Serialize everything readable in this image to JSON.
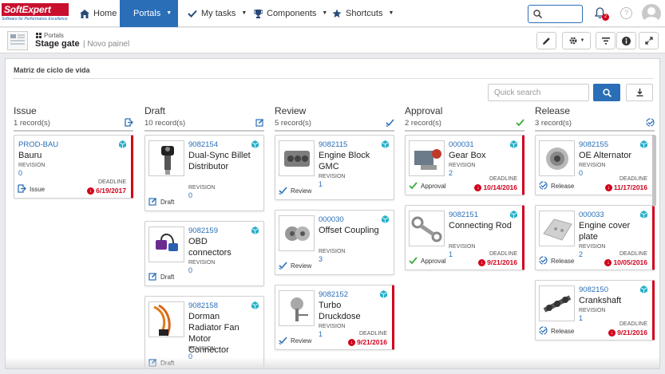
{
  "brand": {
    "name": "SoftExpert",
    "tagline": "Software for Performance Excellence",
    "color": "#c8102e"
  },
  "nav": [
    {
      "label": "Home",
      "icon": "home-icon"
    },
    {
      "label": "Portals",
      "icon": "grid-icon",
      "active": true
    },
    {
      "label": "My tasks",
      "icon": "check-icon"
    },
    {
      "label": "Components",
      "icon": "trophy-icon"
    },
    {
      "label": "Shortcuts",
      "icon": "star-icon"
    }
  ],
  "notifications": {
    "count": "2"
  },
  "help_label": "?",
  "breadcrumb": {
    "label": "Portals"
  },
  "page": {
    "title": "Stage gate",
    "subtitle": "| Novo painel"
  },
  "panel": {
    "title": "Matriz de ciclo de vida",
    "search_placeholder": "Quick search"
  },
  "accent_color": "#2a6eb7",
  "alert_color": "#d0021b",
  "columns": [
    {
      "name": "Issue",
      "count": "1 record(s)",
      "icon": "issue-stage-icon",
      "cards": [
        {
          "id": "PROD-BAU",
          "name": "Bauru",
          "revision_label": "REVISION",
          "revision": "0",
          "stage": "Issue",
          "deadline_label": "DEADLINE",
          "deadline": "6/19/2017",
          "late": true,
          "thumb": "none"
        }
      ]
    },
    {
      "name": "Draft",
      "count": "10 record(s)",
      "icon": "draft-stage-icon",
      "cards": [
        {
          "id": "9082154",
          "name": "Dual-Sync Billet Distributor",
          "revision_label": "REVISION",
          "revision": "0",
          "stage": "Draft",
          "late": false,
          "thumb": "distributor"
        },
        {
          "id": "9082159",
          "name": "OBD connectors",
          "revision_label": "REVISION",
          "revision": "0",
          "stage": "Draft",
          "late": false,
          "thumb": "connector"
        },
        {
          "id": "9082158",
          "name": "Dorman Radiator Fan Motor Connector",
          "revision_label": "REVISION",
          "revision": "0",
          "stage": "Draft",
          "late": false,
          "thumb": "wires"
        }
      ]
    },
    {
      "name": "Review",
      "count": "5 record(s)",
      "icon": "review-stage-icon",
      "cards": [
        {
          "id": "9082115",
          "name": "Engine Block GMC",
          "revision_label": "REVISION",
          "revision": "1",
          "stage": "Review",
          "late": false,
          "thumb": "engine"
        },
        {
          "id": "000030",
          "name": "Offset Coupling",
          "revision_label": "REVISION",
          "revision": "3",
          "stage": "Review",
          "late": false,
          "thumb": "coupling"
        },
        {
          "id": "9082152",
          "name": "Turbo Druckdose",
          "revision_label": "REVISION",
          "revision": "1",
          "stage": "Review",
          "deadline_label": "DEADLINE",
          "deadline": "9/21/2016",
          "late": true,
          "thumb": "turbo"
        }
      ]
    },
    {
      "name": "Approval",
      "count": "2 record(s)",
      "icon": "approval-stage-icon",
      "cards": [
        {
          "id": "000031",
          "name": "Gear Box",
          "revision_label": "REVISION",
          "revision": "2",
          "stage": "Approval",
          "deadline_label": "DEADLINE",
          "deadline": "10/14/2016",
          "late": true,
          "thumb": "gearbox"
        },
        {
          "id": "9082151",
          "name": "Connecting Rod",
          "revision_label": "REVISION",
          "revision": "1",
          "stage": "Approval",
          "deadline_label": "DEADLINE",
          "deadline": "9/21/2016",
          "late": true,
          "thumb": "rod"
        }
      ]
    },
    {
      "name": "Release",
      "count": "3 record(s)",
      "icon": "release-stage-icon",
      "cards": [
        {
          "id": "9082155",
          "name": "OE Alternator",
          "revision_label": "REVISION",
          "revision": "0",
          "stage": "Release",
          "deadline_label": "DEADLINE",
          "deadline": "11/17/2016",
          "late": true,
          "thumb": "alternator"
        },
        {
          "id": "000033",
          "name": "Engine cover plate",
          "revision_label": "REVISION",
          "revision": "2",
          "stage": "Release",
          "deadline_label": "DEADLINE",
          "deadline": "10/05/2016",
          "late": true,
          "thumb": "plate"
        },
        {
          "id": "9082150",
          "name": "Crankshaft",
          "revision_label": "REVISION",
          "revision": "1",
          "stage": "Release",
          "deadline_label": "DEADLINE",
          "deadline": "9/21/2016",
          "late": true,
          "thumb": "crank"
        }
      ]
    }
  ]
}
